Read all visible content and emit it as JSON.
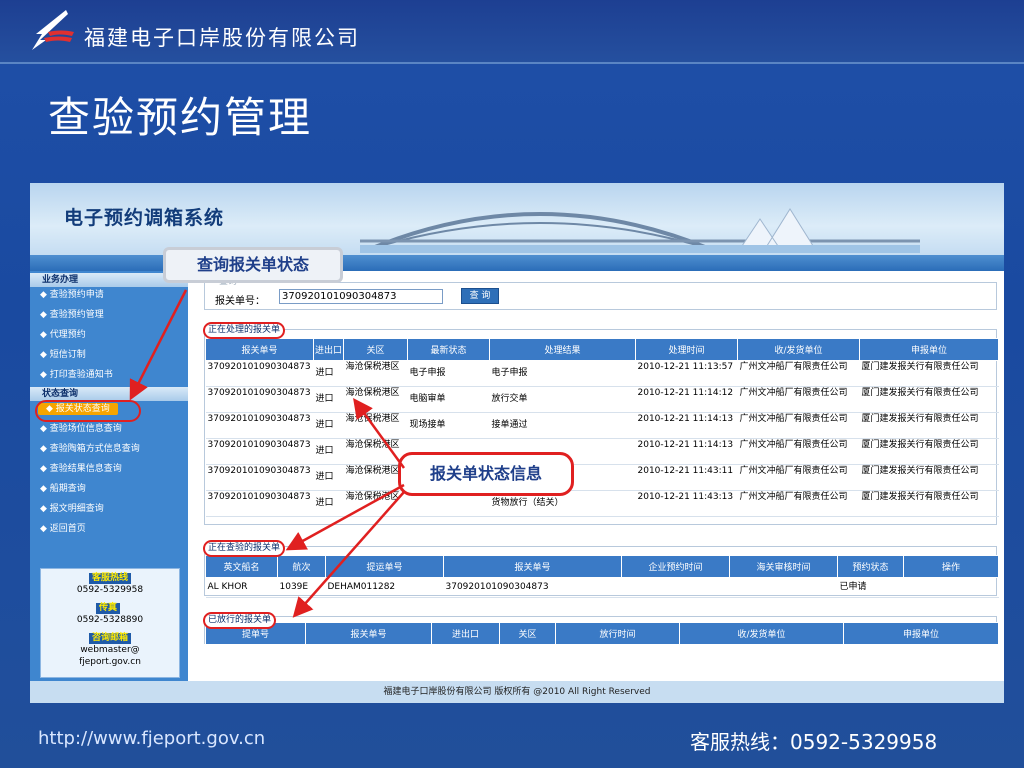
{
  "slide": {
    "company": "福建电子口岸股份有限公司",
    "title": "查验预约管理",
    "url": "http://www.fjeport.gov.cn",
    "hotline": "客服热线：0592-5329958"
  },
  "app": {
    "banner_title": "电子预约调箱系统",
    "sidebar": {
      "sections": [
        "业务办理",
        "状态查询"
      ],
      "business_items": [
        "查验预约申请",
        "查验预约管理",
        "代理预约",
        "短信订制",
        "打印查验通知书"
      ],
      "status_items": [
        "报关状态查询",
        "查验场位信息查询",
        "查验陶箱方式信息查询",
        "查验结果信息查询",
        "船期查询",
        "报文明细查询",
        "返回首页"
      ],
      "contact": {
        "hotline_label": "客服热线",
        "hotline": "0592-5329958",
        "fax_label": "传真",
        "fax": "0592-5328890",
        "email_label": "咨询邮箱",
        "email_line1": "webmaster@",
        "email_line2": "fjeport.gov.cn"
      }
    },
    "search": {
      "hint": "查询",
      "label": "报关单号：",
      "value": "370920101090304873",
      "button": "查 询"
    },
    "processing": {
      "legend": "正在处理的报关单",
      "headers": [
        "报关单号",
        "进出口",
        "关区",
        "最新状态",
        "处理结果",
        "处理时间",
        "收/发货单位",
        "申报单位"
      ],
      "rows": [
        [
          "370920101090304873",
          "进口",
          "海沧保税港区",
          "电子申报",
          "电子申报",
          "2010-12-21 11:13:57",
          "广州文冲船厂有限责任公司",
          "厦门建发报关行有限责任公司"
        ],
        [
          "370920101090304873",
          "进口",
          "海沧保税港区",
          "电脑审单",
          "放行交单",
          "2010-12-21 11:14:12",
          "广州文冲船厂有限责任公司",
          "厦门建发报关行有限责任公司"
        ],
        [
          "370920101090304873",
          "进口",
          "海沧保税港区",
          "现场接单",
          "接单通过",
          "2010-12-21 11:14:13",
          "广州文冲船厂有限责任公司",
          "厦门建发报关行有限责任公司"
        ],
        [
          "370920101090304873",
          "进口",
          "海沧保税港区",
          "",
          "",
          "2010-12-21 11:14:13",
          "广州文冲船厂有限责任公司",
          "厦门建发报关行有限责任公司"
        ],
        [
          "370920101090304873",
          "进口",
          "海沧保税港区",
          "",
          "、货物、单",
          "2010-12-21 11:43:11",
          "广州文冲船厂有限责任公司",
          "厦门建发报关行有限责任公司"
        ],
        [
          "370920101090304873",
          "进口",
          "海沧保税港区",
          "",
          "货物放行（结关）",
          "2010-12-21 11:43:13",
          "广州文冲船厂有限责任公司",
          "厦门建发报关行有限责任公司"
        ]
      ]
    },
    "inspecting": {
      "legend": "正在查验的报关单",
      "headers": [
        "英文船名",
        "航次",
        "提运单号",
        "报关单号",
        "企业预约时间",
        "海关审核时间",
        "预约状态",
        "操作"
      ],
      "rows": [
        [
          "AL KHOR",
          "1039E",
          "DEHAM011282",
          "370920101090304873",
          "",
          "",
          "已申请",
          ""
        ]
      ]
    },
    "released": {
      "legend": "已放行的报关单",
      "headers": [
        "提单号",
        "报关单号",
        "进出口",
        "关区",
        "放行时间",
        "收/发货单位",
        "申报单位"
      ]
    },
    "footer": "福建电子口岸股份有限公司 版权所有 @2010 All Right Reserved"
  },
  "callouts": {
    "query_status": "查询报关单状态",
    "status_info": "报关单状态信息",
    "release_residue": "关）"
  },
  "colors": {
    "accent_red": "#e02020",
    "table_header": "#3a7ac6",
    "slide_bg": "#1f4fa8"
  }
}
